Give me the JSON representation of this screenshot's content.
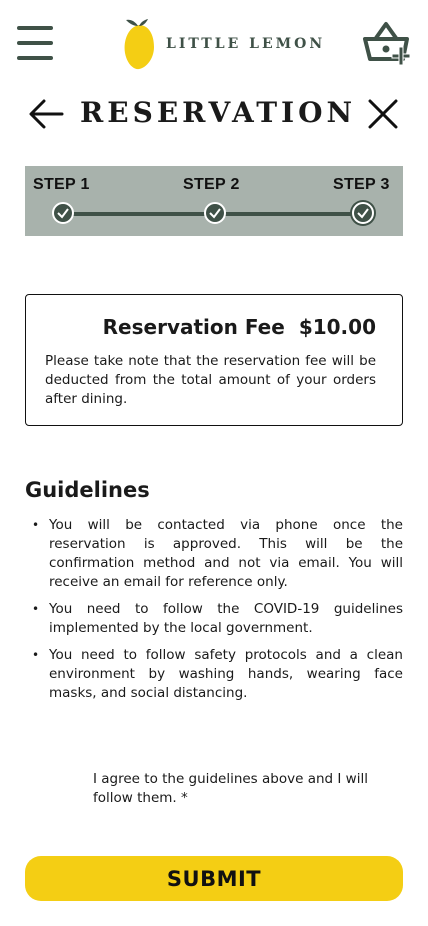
{
  "header": {
    "brand": "LITTLE LEMON",
    "menu_icon": "hamburger-menu-icon",
    "cart_icon": "basket-add-icon"
  },
  "title_bar": {
    "title": "RESERVATION",
    "back_icon": "arrow-left-icon",
    "close_icon": "close-icon"
  },
  "stepper": {
    "steps": [
      {
        "label": "STEP 1",
        "status": "complete"
      },
      {
        "label": "STEP 2",
        "status": "complete"
      },
      {
        "label": "STEP 3",
        "status": "complete"
      }
    ]
  },
  "fee": {
    "label": "Reservation Fee",
    "amount": "$10.00",
    "note": "Please take note that the reservation fee will be deducted from the total amount of your orders after dining."
  },
  "guidelines": {
    "title": "Guidelines",
    "items": [
      "You will be contacted via phone once the reservation is approved. This will be the confirmation method and not via email. You will receive an email for reference only.",
      "You need to follow the COVID-19 guidelines implemented by the local government.",
      "You need to follow safety protocols and a clean environment by washing hands, wearing face masks, and social distancing."
    ]
  },
  "agreement": {
    "text": "I agree to the guidelines above and I will follow them.  *"
  },
  "submit_label": "SUBMIT",
  "colors": {
    "brand_green": "#3f5147",
    "lemon_yellow": "#f4ce14",
    "stepper_bg": "#a8b2ac"
  }
}
